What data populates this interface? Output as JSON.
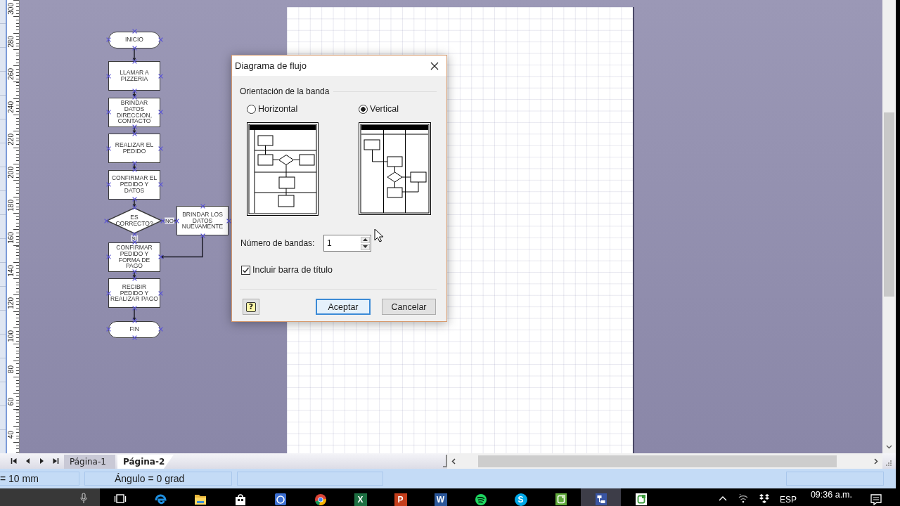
{
  "ruler": {
    "labels": [
      "300",
      "280",
      "260",
      "240",
      "220",
      "200",
      "180",
      "160",
      "140",
      "120",
      "100",
      "80",
      "60",
      "40"
    ]
  },
  "flowchart": {
    "connection_points": true,
    "steps": [
      {
        "kind": "terminal",
        "text": "INICIO"
      },
      {
        "kind": "process",
        "text": "LLAMAR A PIZZERIA"
      },
      {
        "kind": "process",
        "text": "BRINDAR DATOS DIRECCION, CONTACTO"
      },
      {
        "kind": "process",
        "text": "REALIZAR EL PEDIDO"
      },
      {
        "kind": "process",
        "text": "CONFIRMAR EL PEDIDO Y DATOS"
      },
      {
        "kind": "decision",
        "text": "ES CORRECTO?",
        "yes_label": "SI",
        "no_label": "NO",
        "no_branch": {
          "kind": "process",
          "text": "BRINDAR LOS DATOS NUEVAMENTE"
        }
      },
      {
        "kind": "process",
        "text": "CONFIRMAR PEDIDO Y FORMA DE PAGO"
      },
      {
        "kind": "process",
        "text": "RECIBIR PEDIDO Y REALIZAR PAGO"
      },
      {
        "kind": "terminal",
        "text": "FIN"
      }
    ]
  },
  "dialog": {
    "title": "Diagrama de flujo",
    "group_label": "Orientación de la banda",
    "orientations": [
      {
        "kind": "horizontal",
        "label": "Horizontal",
        "selected": false
      },
      {
        "kind": "vertical",
        "label": "Vertical",
        "selected": true
      }
    ],
    "band_count": {
      "label": "Número de bandas:",
      "value": "1"
    },
    "include_title_bar": {
      "label": "Incluir barra de título",
      "checked": true
    },
    "help_button": "?",
    "buttons": [
      {
        "label": "Aceptar",
        "default": true
      },
      {
        "label": "Cancelar",
        "default": false
      }
    ]
  },
  "page_tabs": [
    {
      "label": "Página-1",
      "selected": false
    },
    {
      "label": "Página-2",
      "selected": true
    }
  ],
  "status_bar": {
    "panes": [
      "= 10 mm",
      "Ángulo = 0 grad"
    ]
  },
  "taskbar": {
    "apps": [
      {
        "kind": "task-view",
        "active": false
      },
      {
        "kind": "edge",
        "active": false
      },
      {
        "kind": "folder",
        "active": false
      },
      {
        "kind": "store",
        "active": false
      },
      {
        "kind": "help",
        "active": false
      },
      {
        "kind": "chrome",
        "active": false
      },
      {
        "kind": "excel",
        "letter": "X",
        "active": false
      },
      {
        "kind": "powerpoint",
        "letter": "P",
        "active": false
      },
      {
        "kind": "word",
        "letter": "W",
        "active": false
      },
      {
        "kind": "spotify",
        "active": false
      },
      {
        "kind": "skype",
        "letter": "S",
        "active": false
      },
      {
        "kind": "camtasia",
        "active": false
      },
      {
        "kind": "visio",
        "active": true
      },
      {
        "kind": "app",
        "active": false
      }
    ],
    "language": "ESP",
    "clock": "09:36 a.m."
  }
}
